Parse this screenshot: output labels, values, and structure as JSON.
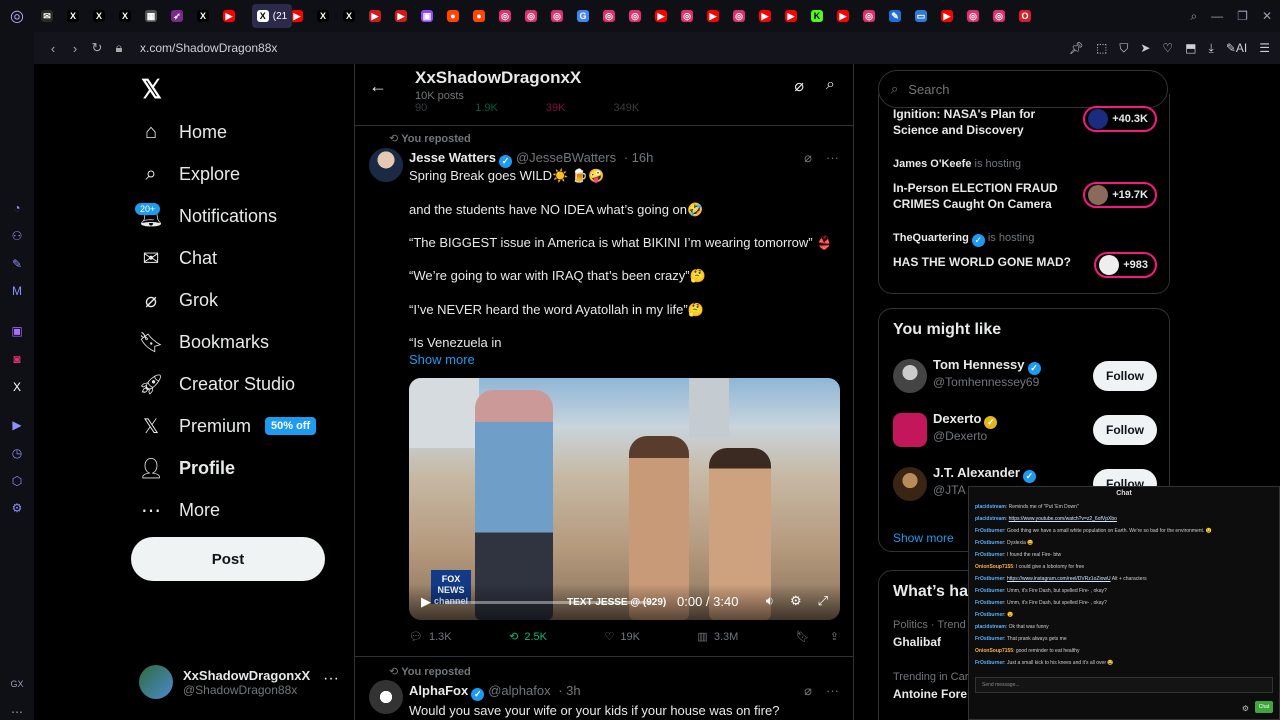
{
  "browser": {
    "url": "x.com/ShadowDragon88x",
    "active_tab_label": "(21",
    "tab_icons": [
      "mail-icon",
      "x-icon",
      "x-icon",
      "x-icon",
      "image-icon",
      "bird-icon",
      "x-icon",
      "youtube-icon",
      "youtube-icon",
      "x-icon",
      "x-icon",
      "play-icon",
      "play-icon",
      "twitch-icon",
      "reddit-icon",
      "reddit-icon",
      "instagram-icon",
      "instagram-icon",
      "instagram-icon",
      "google-icon",
      "instagram-icon",
      "instagram-icon",
      "youtube-icon",
      "instagram-icon",
      "youtube-icon",
      "instagram-icon",
      "youtube-icon",
      "youtube-icon",
      "kick-icon",
      "youtube-icon",
      "instagram-icon",
      "edit-icon",
      "monitor-icon",
      "youtube-icon",
      "instagram-icon",
      "instagram-icon",
      "opera-icon"
    ],
    "ai_label": "AI"
  },
  "colors": {
    "accent": "#1d9bf0",
    "repost_green": "#00ba7c",
    "live_pink": "#f91880"
  },
  "nav": {
    "items": [
      {
        "label": "Home",
        "icon": "home-icon"
      },
      {
        "label": "Explore",
        "icon": "search-icon"
      },
      {
        "label": "Notifications",
        "icon": "bell-icon",
        "badge": "20+"
      },
      {
        "label": "Chat",
        "icon": "mail-icon"
      },
      {
        "label": "Grok",
        "icon": "grok-icon"
      },
      {
        "label": "Bookmarks",
        "icon": "bookmark-icon"
      },
      {
        "label": "Creator Studio",
        "icon": "rocket-icon"
      },
      {
        "label": "Premium",
        "icon": "x-icon",
        "promo": "50% off"
      },
      {
        "label": "Profile",
        "icon": "person-icon"
      },
      {
        "label": "More",
        "icon": "more-circle-icon"
      }
    ],
    "post_label": "Post",
    "account": {
      "name": "XxShadowDragonxX",
      "handle": "@ShadowDragon88x"
    }
  },
  "profile_header": {
    "title": "XxShadowDragonxX",
    "subtitle": "10K posts"
  },
  "prev_tweet_metrics": {
    "replies": "90",
    "reposts": "1.9K",
    "likes": "39K",
    "views": "349K"
  },
  "tweets": [
    {
      "repost_label": "You reposted",
      "author": "Jesse Watters",
      "handle": "@JesseBWatters",
      "time": "· 16h",
      "lines": [
        "Spring Break goes WILD☀️ 🍺🤪",
        "and the students have NO IDEA what’s going on🤣",
        "“The BIGGEST issue in America is what BIKINI I’m wearing tomorrow” 👙",
        "“We’re going to war with IRAQ that’s been crazy”🤔",
        "“I’ve NEVER heard the word Ayatollah in my life”🤔",
        "“Is Venezuela in"
      ],
      "show_more": "Show more",
      "video": {
        "time": "0:00 / 3:40",
        "chyron": "TEXT JESSE @ (929)",
        "network": "FOX NEWS channel"
      },
      "metrics": {
        "replies": "1.3K",
        "reposts": "2.5K",
        "likes": "19K",
        "views": "3.3M"
      }
    },
    {
      "repost_label": "You reposted",
      "author": "AlphaFox",
      "handle": "@alphafox",
      "time": "· 3h",
      "text": "Would you save your wife or your kids if your house was on fire?"
    }
  ],
  "right": {
    "search_placeholder": "Search",
    "spaces": [
      {
        "host": "",
        "title_line1": "Ignition: NASA's Plan for",
        "title_line2": "Science and Discovery",
        "count": "+40.3K"
      },
      {
        "host": "James O'Keefe",
        "hosting": "is hosting",
        "title_line1": "In-Person ELECTION FRAUD",
        "title_line2": "CRIMES Caught On Camera",
        "count": "+19.7K"
      },
      {
        "host": "TheQuartering",
        "hosting": "is hosting",
        "title_line1": "HAS THE WORLD GONE MAD?",
        "title_line2": "",
        "count": "+983"
      }
    ],
    "wtf_title": "You might like",
    "wtf": [
      {
        "name": "Tom Hennessy",
        "handle": "@Tomhennessey69",
        "follow": "Follow"
      },
      {
        "name": "Dexerto",
        "handle": "@Dexerto",
        "follow": "Follow"
      },
      {
        "name": "J.T. Alexander",
        "handle": "@JTA",
        "follow": "Follow"
      }
    ],
    "show_more": "Show more",
    "happening_title": "What’s ha",
    "trends": [
      {
        "category": "Politics · Trend",
        "name": "Ghalibaf"
      },
      {
        "category": "Trending in Car",
        "name": "Antoine Fore"
      }
    ]
  },
  "chat": {
    "title": "Chat",
    "messages": [
      {
        "user": "placidstream",
        "text": "Reminds me of \"Put 'Em Down\""
      },
      {
        "user": "placidstream",
        "text": "",
        "link": "https://www.youtube.com/watch?v=z2_6ofVpXbo"
      },
      {
        "user": "FrOstburner",
        "text": "Good thing we have a small white population on Earth. We're so bad for the environment. 😉"
      },
      {
        "user": "FrOstburner",
        "text": "Dyslexia 😄"
      },
      {
        "user": "FrOstburner",
        "text": "I found the real Fire- btw"
      },
      {
        "user": "OnionSoup7155",
        "text": "I could give a lobotomy for free"
      },
      {
        "user": "FrOstburner",
        "text": "Alt + characters",
        "link": "https://www.instagram.com/reel/DVRz1oZiowU"
      },
      {
        "user": "FrOstburner",
        "text": "Umm, it's Fire Dash, but spelled Fire- , okay?"
      },
      {
        "user": "FrOstburner",
        "text": "Umm, it's Fire Dash, but spelled Fire- , okay?"
      },
      {
        "user": "FrOstburner",
        "text": "😉"
      },
      {
        "user": "placidstream",
        "text": "Ok that was funny"
      },
      {
        "user": "FrOstburner",
        "text": "That prank always gets me"
      },
      {
        "user": "OnionSoup7155",
        "text": "good reminder to eat healthy"
      },
      {
        "user": "FrOstburner",
        "text": "Just a small kick to his knees and it's all over 😂"
      }
    ],
    "input_placeholder": "Send message...",
    "send_label": "Chat"
  }
}
